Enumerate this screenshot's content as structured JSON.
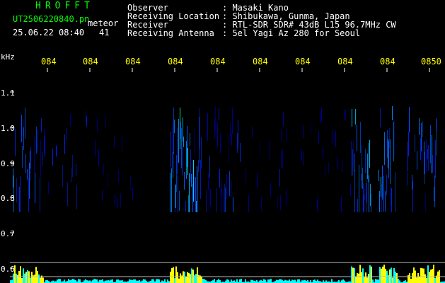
{
  "header": {
    "logo": "HROFFT",
    "filename": "UT2506220840.pn",
    "meteor_label": "meteor",
    "datetime": "25.06.22 08:40",
    "count": "41",
    "info": [
      {
        "label": "Observer",
        "value": ": Masaki Kano"
      },
      {
        "label": "Receiving Location",
        "value": ": Shibukawa, Gunma, Japan"
      },
      {
        "label": "Receiver",
        "value": ": RTL-SDR SDR# 43dB L15 96.7MHz CW"
      },
      {
        "label": "Receiving Antenna",
        "value": ": 5el Yagi Az 280 for Seoul"
      }
    ]
  },
  "axis": {
    "freq_unit": "kHz",
    "time_ticks": [
      "084",
      "084",
      "084",
      "084",
      "084",
      "084",
      "084",
      "084",
      "084",
      "0850"
    ],
    "freq_ticks": [
      "1.1",
      "1.0",
      "0.9",
      "0.8",
      "0.7",
      "0.6"
    ]
  },
  "colors": {
    "background": "#000000",
    "text": "#ffffff",
    "logo": "#00ff00",
    "ticks": "#ffff00",
    "level_fill": "#00ffff",
    "level_peak": "#ffff00",
    "gridline": "#bbbbbb"
  }
}
